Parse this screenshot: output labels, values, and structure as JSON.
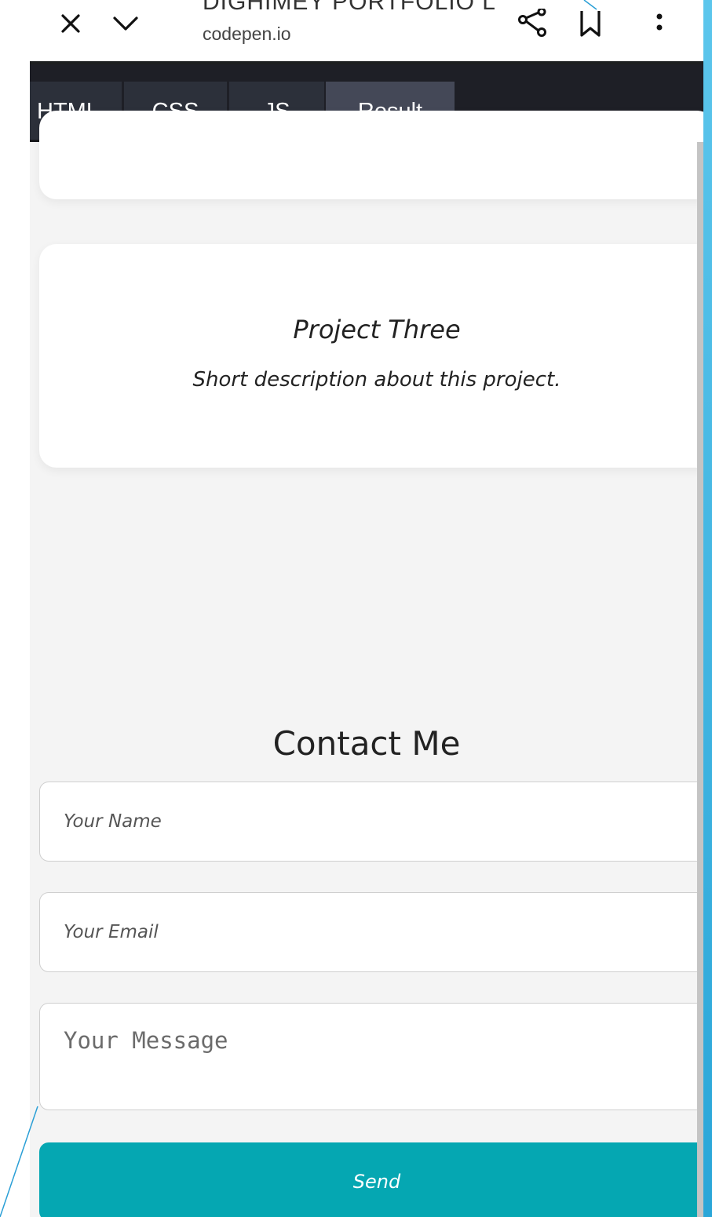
{
  "browser": {
    "page_title": "DIGHIMEY PORTFOLIO L",
    "url": "codepen.io",
    "icons": [
      "close-icon",
      "chevron-down-icon",
      "share-icon",
      "bookmark-icon",
      "more-vert-icon"
    ]
  },
  "tabs": [
    {
      "label": "HTML",
      "active": false
    },
    {
      "label": "CSS",
      "active": false
    },
    {
      "label": "JS",
      "active": false
    },
    {
      "label": "Result",
      "active": true
    }
  ],
  "projects": [
    {
      "title": "Project Three",
      "description": "Short description about this project."
    }
  ],
  "contact": {
    "heading": "Contact Me",
    "name_placeholder": "Your Name",
    "email_placeholder": "Your Email",
    "message_placeholder": "Your Message",
    "send_label": "Send"
  },
  "colors": {
    "accent": "#05a7b2",
    "tab_bar": "#1e1f26",
    "tab_active": "#444857",
    "page_background": "#f4f4f4"
  }
}
